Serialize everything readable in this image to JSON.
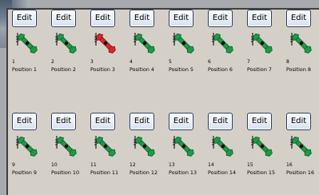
{
  "positions": [
    {
      "edit_label": "Edit",
      "number": "1",
      "label": "Position 1",
      "tool_state": "green"
    },
    {
      "edit_label": "Edit",
      "number": "2",
      "label": "Position 2",
      "tool_state": "green"
    },
    {
      "edit_label": "Edit",
      "number": "3",
      "label": "Position 3",
      "tool_state": "red"
    },
    {
      "edit_label": "Edit",
      "number": "4",
      "label": "Position 4",
      "tool_state": "green"
    },
    {
      "edit_label": "Edit",
      "number": "5",
      "label": "Position 5",
      "tool_state": "green"
    },
    {
      "edit_label": "Edit",
      "number": "6",
      "label": "Position 6",
      "tool_state": "green"
    },
    {
      "edit_label": "Edit",
      "number": "7",
      "label": "Position 7",
      "tool_state": "green"
    },
    {
      "edit_label": "Edit",
      "number": "8",
      "label": "Position 8",
      "tool_state": "green"
    },
    {
      "edit_label": "Edit",
      "number": "9",
      "label": "Position 9",
      "tool_state": "green"
    },
    {
      "edit_label": "Edit",
      "number": "10",
      "label": "Position 10",
      "tool_state": "green"
    },
    {
      "edit_label": "Edit",
      "number": "11",
      "label": "Position 11",
      "tool_state": "green"
    },
    {
      "edit_label": "Edit",
      "number": "12",
      "label": "Position 12",
      "tool_state": "green"
    },
    {
      "edit_label": "Edit",
      "number": "13",
      "label": "Position 13",
      "tool_state": "green"
    },
    {
      "edit_label": "Edit",
      "number": "14",
      "label": "Position 14",
      "tool_state": "green"
    },
    {
      "edit_label": "Edit",
      "number": "15",
      "label": "Position 15",
      "tool_state": "green"
    },
    {
      "edit_label": "Edit",
      "number": "16",
      "label": "Position 16",
      "tool_state": "green"
    }
  ],
  "colors": {
    "tool_green": "#1f9a47",
    "tool_green_dark": "#0e5f2a",
    "tool_red": "#d9262b",
    "tool_red_dark": "#8c1115"
  },
  "icons": {
    "tool": "wrench-tool-icon"
  }
}
